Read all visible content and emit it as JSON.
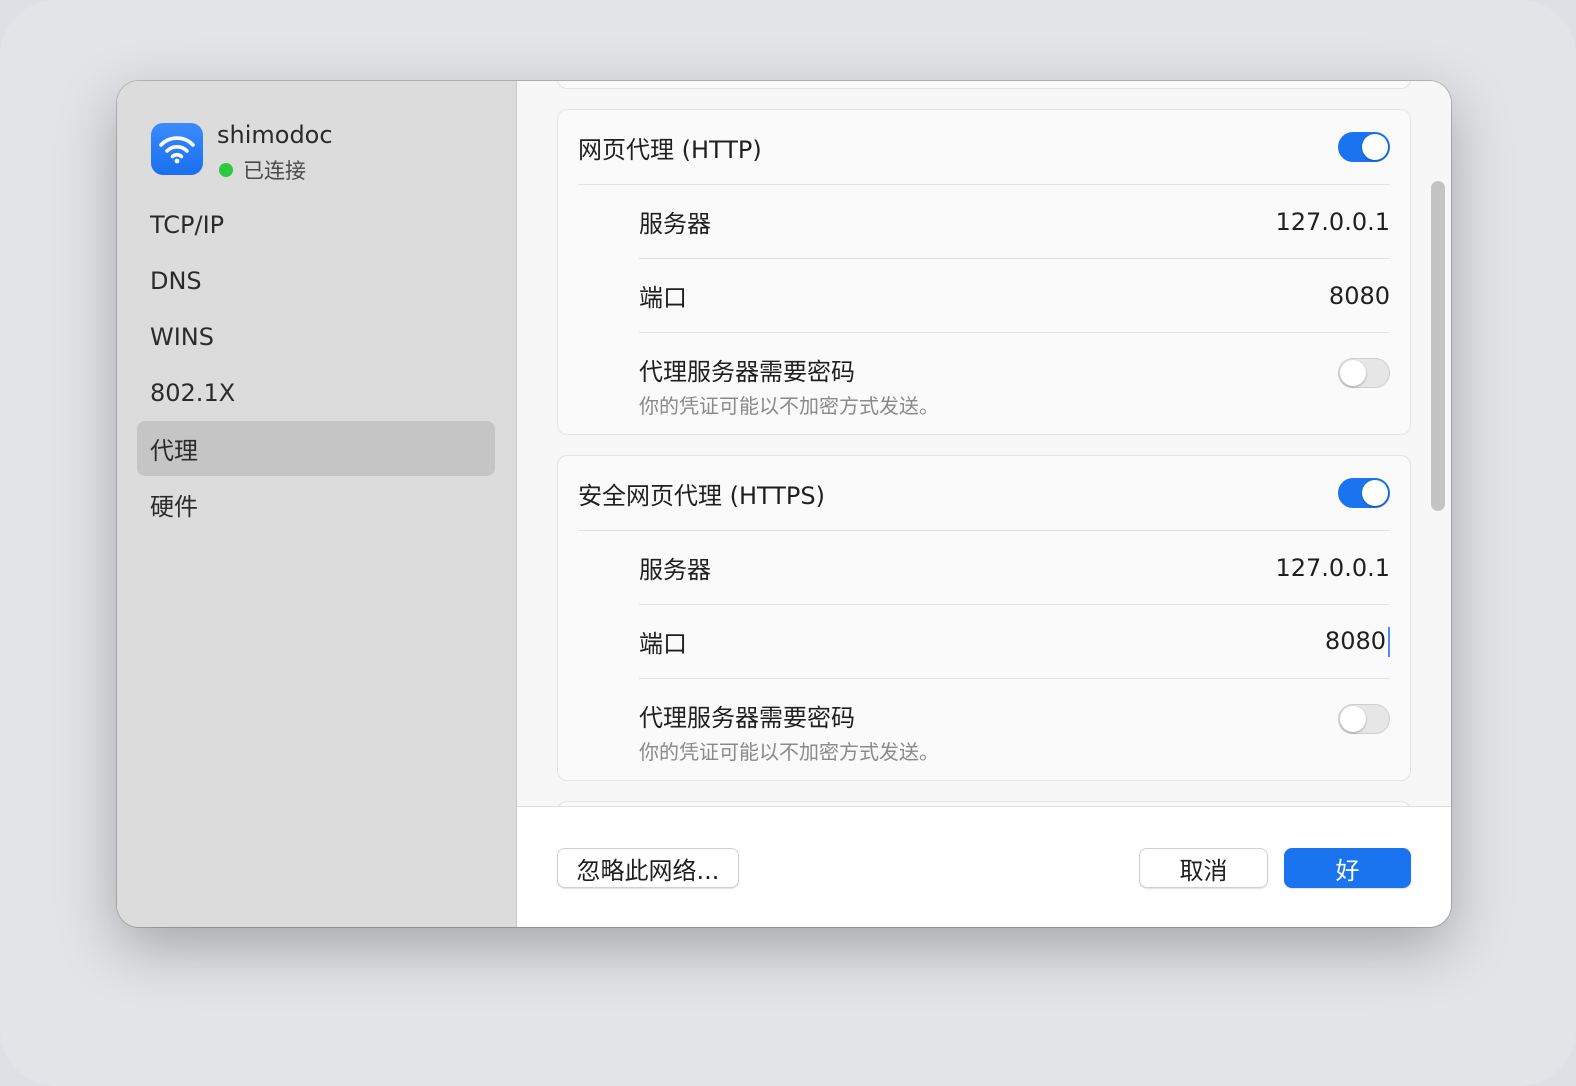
{
  "network": {
    "name": "shimodoc",
    "status": "已连接",
    "icon": "wifi-icon",
    "status_color": "#2bc840"
  },
  "sidebar": {
    "items": [
      {
        "label": "TCP/IP",
        "active": false
      },
      {
        "label": "DNS",
        "active": false
      },
      {
        "label": "WINS",
        "active": false
      },
      {
        "label": "802.1X",
        "active": false
      },
      {
        "label": "代理",
        "active": true
      },
      {
        "label": "硬件",
        "active": false
      }
    ]
  },
  "http_proxy": {
    "title": "网页代理 (HTTP)",
    "enabled": true,
    "server_label": "服务器",
    "server_value": "127.0.0.1",
    "port_label": "端口",
    "port_value": "8080",
    "password_label": "代理服务器需要密码",
    "password_note": "你的凭证可能以不加密方式发送。",
    "password_required": false
  },
  "https_proxy": {
    "title": "安全网页代理 (HTTPS)",
    "enabled": true,
    "server_label": "服务器",
    "server_value": "127.0.0.1",
    "port_label": "端口",
    "port_value": "8080",
    "password_label": "代理服务器需要密码",
    "password_note": "你的凭证可能以不加密方式发送。",
    "password_required": false
  },
  "footer": {
    "forget_label": "忽略此网络...",
    "cancel_label": "取消",
    "ok_label": "好"
  },
  "colors": {
    "accent": "#1a74f0",
    "sidebar_bg": "#dcdcdc",
    "sidebar_active": "#c5c5c5"
  }
}
